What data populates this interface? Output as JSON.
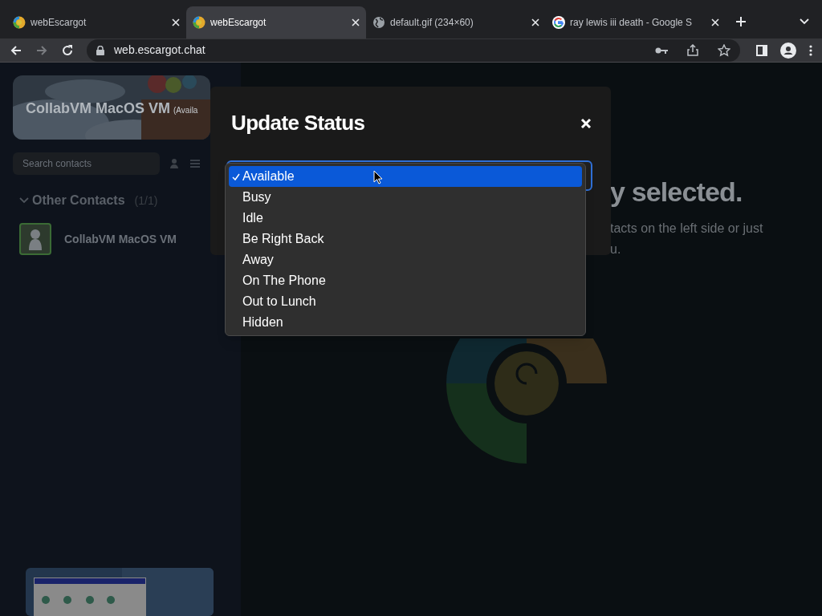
{
  "browser": {
    "tabs": [
      {
        "title": "webEscargot",
        "kind": "escargot",
        "selected": false
      },
      {
        "title": "webEscargot",
        "kind": "escargot",
        "selected": true
      },
      {
        "title": "default.gif (234×60)",
        "kind": "globe",
        "selected": false
      },
      {
        "title": "ray lewis iii death - Google S",
        "kind": "google",
        "selected": false
      }
    ],
    "url": "web.escargot.chat"
  },
  "sidebar": {
    "profile": {
      "name": "CollabVM MacOS VM",
      "status": "(Availa"
    },
    "search": {
      "placeholder": "Search contacts"
    },
    "groups": [
      {
        "name": "Other Contacts",
        "count": "(1/1)",
        "expanded": true,
        "contacts": [
          {
            "name": "CollabVM MacOS VM"
          }
        ]
      }
    ]
  },
  "main": {
    "heading": "y selected.",
    "lines": [
      "tacts on the left side or just",
      "u."
    ]
  },
  "dialog": {
    "title": "Update Status",
    "options": [
      {
        "label": "Available",
        "selected": true
      },
      {
        "label": "Busy",
        "selected": false
      },
      {
        "label": "Idle",
        "selected": false
      },
      {
        "label": "Be Right Back",
        "selected": false
      },
      {
        "label": "Away",
        "selected": false
      },
      {
        "label": "On The Phone",
        "selected": false
      },
      {
        "label": "Out to Lunch",
        "selected": false
      },
      {
        "label": "Hidden",
        "selected": false
      }
    ]
  }
}
